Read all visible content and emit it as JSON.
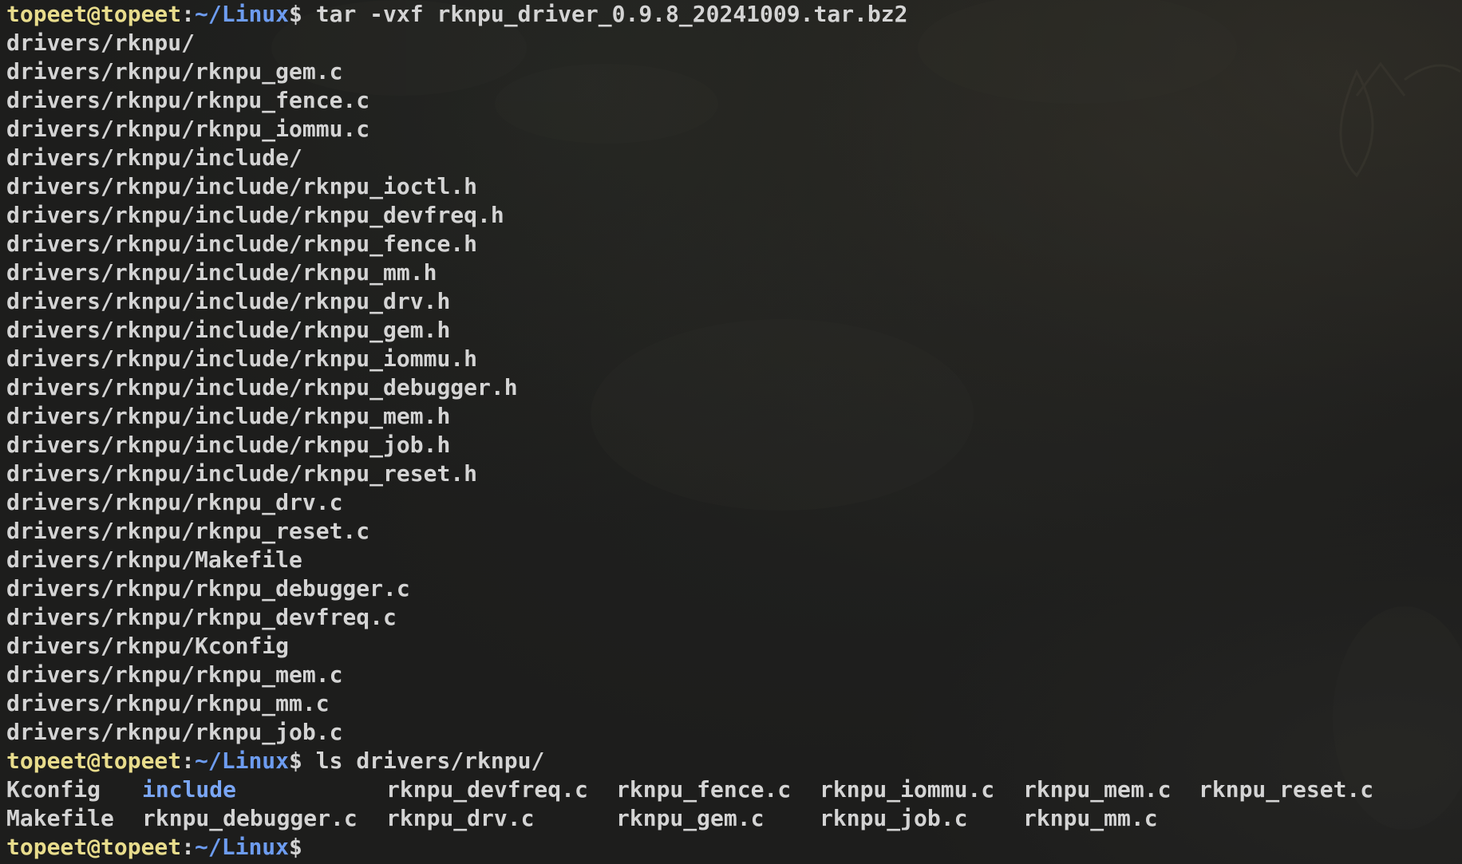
{
  "prompt": {
    "user_host": "topeet@topeet",
    "colon": ":",
    "path": "~/Linux",
    "dollar": "$"
  },
  "commands": {
    "tar_cmd": " tar -vxf rknpu_driver_0.9.8_20241009.tar.bz2",
    "ls_cmd": " ls drivers/rknpu/"
  },
  "tar_output": [
    "drivers/rknpu/",
    "drivers/rknpu/rknpu_gem.c",
    "drivers/rknpu/rknpu_fence.c",
    "drivers/rknpu/rknpu_iommu.c",
    "drivers/rknpu/include/",
    "drivers/rknpu/include/rknpu_ioctl.h",
    "drivers/rknpu/include/rknpu_devfreq.h",
    "drivers/rknpu/include/rknpu_fence.h",
    "drivers/rknpu/include/rknpu_mm.h",
    "drivers/rknpu/include/rknpu_drv.h",
    "drivers/rknpu/include/rknpu_gem.h",
    "drivers/rknpu/include/rknpu_iommu.h",
    "drivers/rknpu/include/rknpu_debugger.h",
    "drivers/rknpu/include/rknpu_mem.h",
    "drivers/rknpu/include/rknpu_job.h",
    "drivers/rknpu/include/rknpu_reset.h",
    "drivers/rknpu/rknpu_drv.c",
    "drivers/rknpu/rknpu_reset.c",
    "drivers/rknpu/Makefile",
    "drivers/rknpu/rknpu_debugger.c",
    "drivers/rknpu/rknpu_devfreq.c",
    "drivers/rknpu/Kconfig",
    "drivers/rknpu/rknpu_mem.c",
    "drivers/rknpu/rknpu_mm.c",
    "drivers/rknpu/rknpu_job.c"
  ],
  "ls_output": {
    "row1": [
      "Kconfig",
      "include",
      "rknpu_devfreq.c",
      "rknpu_fence.c",
      "rknpu_iommu.c",
      "rknpu_mem.c",
      "rknpu_reset.c"
    ],
    "row2": [
      "Makefile",
      "rknpu_debugger.c",
      "rknpu_drv.c",
      "rknpu_gem.c",
      "rknpu_job.c",
      "rknpu_mm.c"
    ]
  },
  "colors": {
    "background": "#1d1d1c",
    "text": "#d4d4d4",
    "user_host": "#e8dc8c",
    "path": "#6d9cf0",
    "directory": "#7aa6f5"
  }
}
